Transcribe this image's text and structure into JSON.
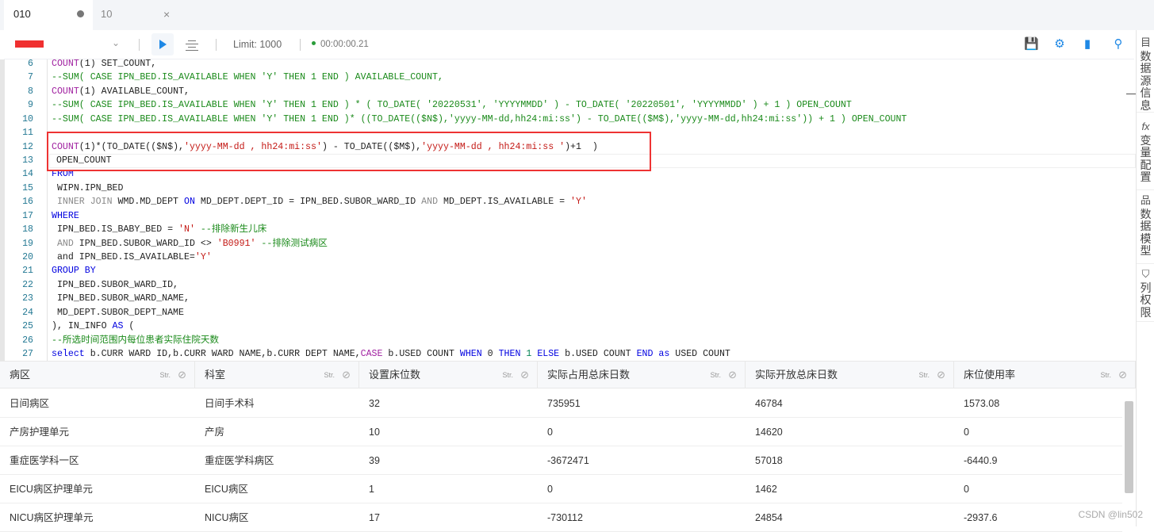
{
  "tabs": [
    {
      "label": "010",
      "modified": true
    },
    {
      "label": "10",
      "close": "×"
    }
  ],
  "toolbar": {
    "datasource_redacted": true,
    "limit": "Limit: 1000",
    "elapsed": "00:00:00.21",
    "icons": [
      "save-icon",
      "settings-icon",
      "copy-icon",
      "search-icon"
    ]
  },
  "sidebar": [
    {
      "icon": "目",
      "label": "数据源信息"
    },
    {
      "icon": "fx",
      "label": "变量配置"
    },
    {
      "icon": "品",
      "label": "数据模型"
    },
    {
      "icon": "⛉",
      "label": "列权限"
    }
  ],
  "colors": {
    "accent": "#1e88e5",
    "highlight_box": "#ee3333",
    "comment": "#1a8a1a",
    "string": "#c41a16",
    "keyword": "#0000e0",
    "function": "#a020a0"
  },
  "editor": {
    "lines": [
      {
        "n": "6",
        "t": [
          [
            "f",
            "COUNT"
          ],
          [
            "d",
            "(1) SET_COUNT,"
          ]
        ]
      },
      {
        "n": "7",
        "t": [
          [
            "c",
            "--SUM( CASE IPN_BED.IS_AVAILABLE WHEN 'Y' THEN 1 END ) AVAILABLE_COUNT,"
          ]
        ]
      },
      {
        "n": "8",
        "t": [
          [
            "f",
            "COUNT"
          ],
          [
            "d",
            "(1) AVAILABLE_COUNT,"
          ]
        ]
      },
      {
        "n": "9",
        "t": [
          [
            "c",
            "--SUM( CASE IPN_BED.IS_AVAILABLE WHEN 'Y' THEN 1 END ) * ( TO_DATE( '20220531', 'YYYYMMDD' ) - TO_DATE( '20220501', 'YYYYMMDD' ) + 1 ) OPEN_COUNT"
          ]
        ]
      },
      {
        "n": "10",
        "t": [
          [
            "c",
            "--SUM( CASE IPN_BED.IS_AVAILABLE WHEN 'Y' THEN 1 END )* ((TO_DATE(($N$),'yyyy-MM-dd,hh24:mi:ss') - TO_DATE(($M$),'yyyy-MM-dd,hh24:mi:ss')) + 1 ) OPEN_COUNT"
          ]
        ]
      },
      {
        "n": "11",
        "t": []
      },
      {
        "n": "12",
        "t": [
          [
            "f",
            "COUNT"
          ],
          [
            "d",
            "(1)*(TO_DATE(($N$),"
          ],
          [
            "s",
            "'yyyy-MM-dd , hh24:mi:ss'"
          ],
          [
            "d",
            ") - TO_DATE(($M$),"
          ],
          [
            "s",
            "'yyyy-MM-dd , hh24:mi:ss '"
          ],
          [
            "d",
            ")+1  )"
          ]
        ]
      },
      {
        "n": "13",
        "t": [
          [
            "d",
            "OPEN_COUNT"
          ]
        ]
      },
      {
        "n": "14",
        "t": [
          [
            "k",
            "FROM"
          ]
        ]
      },
      {
        "n": "15",
        "t": [
          [
            "d",
            " WIPN.IPN_BED"
          ]
        ]
      },
      {
        "n": "16",
        "t": [
          [
            "g",
            " INNER JOIN"
          ],
          [
            "d",
            " WMD.MD_DEPT "
          ],
          [
            "k",
            "ON"
          ],
          [
            "d",
            " MD_DEPT.DEPT_ID = IPN_BED.SUBOR_WARD_ID "
          ],
          [
            "g",
            "AND"
          ],
          [
            "d",
            " MD_DEPT.IS_AVAILABLE = "
          ],
          [
            "s",
            "'Y'"
          ]
        ]
      },
      {
        "n": "17",
        "t": [
          [
            "k",
            "WHERE"
          ]
        ]
      },
      {
        "n": "18",
        "t": [
          [
            "d",
            " IPN_BED.IS_BABY_BED = "
          ],
          [
            "s",
            "'N'"
          ],
          [
            "c",
            " --排除新生儿床"
          ]
        ]
      },
      {
        "n": "19",
        "t": [
          [
            "g",
            " AND"
          ],
          [
            "d",
            " IPN_BED.SUBOR_WARD_ID <> "
          ],
          [
            "s",
            "'B0991'"
          ],
          [
            "c",
            " --排除测试病区"
          ]
        ]
      },
      {
        "n": "20",
        "t": [
          [
            "d",
            " and IPN_BED.IS_AVAILABLE="
          ],
          [
            "s",
            "'Y'"
          ]
        ]
      },
      {
        "n": "21",
        "t": [
          [
            "k",
            "GROUP BY"
          ]
        ]
      },
      {
        "n": "22",
        "t": [
          [
            "d",
            " IPN_BED.SUBOR_WARD_ID,"
          ]
        ]
      },
      {
        "n": "23",
        "t": [
          [
            "d",
            " IPN_BED.SUBOR_WARD_NAME,"
          ]
        ]
      },
      {
        "n": "24",
        "t": [
          [
            "d",
            " MD_DEPT.SUBOR_DEPT_NAME"
          ]
        ]
      },
      {
        "n": "25",
        "t": [
          [
            "d",
            "), IN_INFO "
          ],
          [
            "k",
            "AS"
          ],
          [
            "d",
            " ("
          ]
        ]
      },
      {
        "n": "26",
        "t": [
          [
            "c",
            "--所选时间范围内每位患者实际住院天数"
          ]
        ]
      },
      {
        "n": "27",
        "t": [
          [
            "k",
            "select"
          ],
          [
            "d",
            " b.CURR WARD ID,b.CURR WARD NAME,b.CURR DEPT NAME,"
          ],
          [
            "f",
            "CASE"
          ],
          [
            "d",
            " b.USED COUNT "
          ],
          [
            "k",
            "WHEN"
          ],
          [
            "d",
            " 0 "
          ],
          [
            "k",
            "THEN"
          ],
          [
            "n",
            " 1 "
          ],
          [
            "k",
            "ELSE"
          ],
          [
            "d",
            " b.USED COUNT "
          ],
          [
            "k",
            "END"
          ],
          [
            "d",
            " "
          ],
          [
            "k",
            "as"
          ],
          [
            "d",
            " USED COUNT"
          ]
        ]
      }
    ]
  },
  "grid": {
    "type_tag": "Str.",
    "columns": [
      "病区",
      "科室",
      "设置床位数",
      "实际占用总床日数",
      "实际开放总床日数",
      "床位使用率"
    ],
    "rows": [
      [
        "日间病区",
        "日间手术科",
        "32",
        "735951",
        "46784",
        "1573.08"
      ],
      [
        "产房护理单元",
        "产房",
        "10",
        "0",
        "14620",
        "0"
      ],
      [
        "重症医学科一区",
        "重症医学科病区",
        "39",
        "-3672471",
        "57018",
        "-6440.9"
      ],
      [
        "EICU病区护理单元",
        "EICU病区",
        "1",
        "0",
        "1462",
        "0"
      ],
      [
        "NICU病区护理单元",
        "NICU病区",
        "17",
        "-730112",
        "24854",
        "-2937.6"
      ]
    ]
  },
  "watermark": "CSDN @lin502"
}
